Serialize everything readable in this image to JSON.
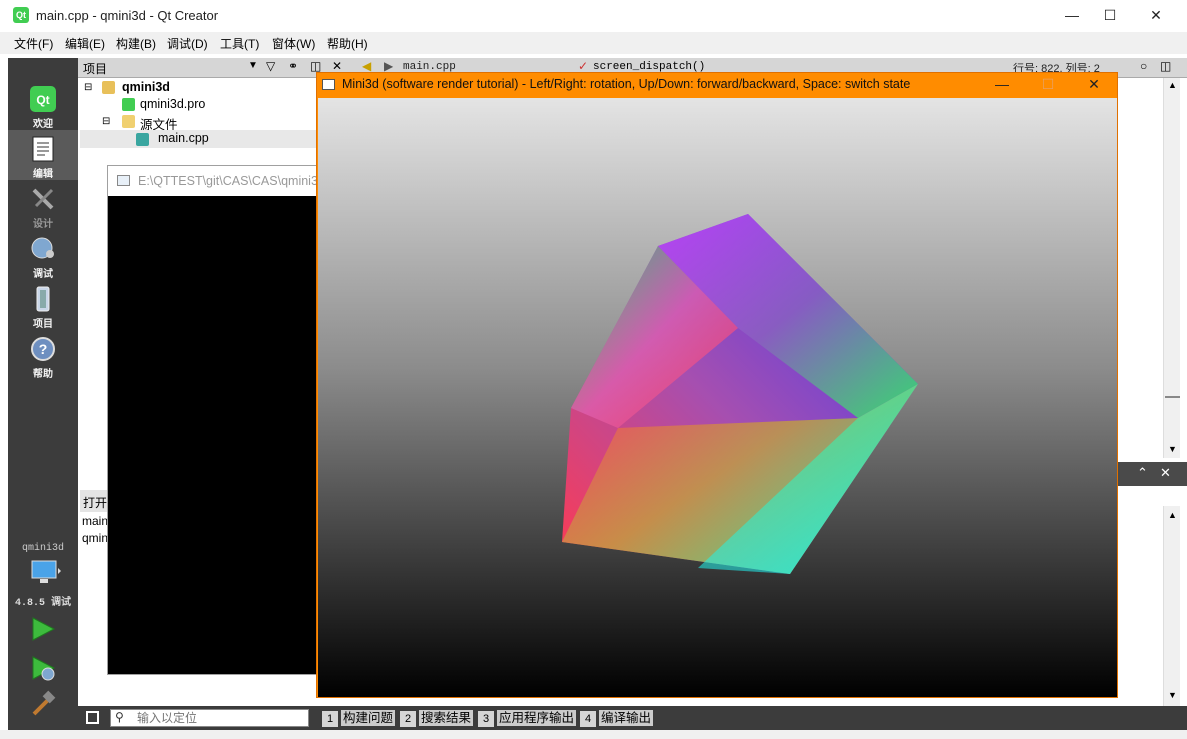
{
  "qt_creator": {
    "title": "main.cpp - qmini3d - Qt Creator",
    "icon": "qt-logo-icon",
    "menu": [
      "文件(F)",
      "编辑(E)",
      "构建(B)",
      "调试(D)",
      "工具(T)",
      "窗体(W)",
      "帮助(H)"
    ],
    "window_controls": [
      "minimize",
      "maximize",
      "close"
    ]
  },
  "modes": [
    {
      "label": "欢迎",
      "icon": "qt-welcome-icon",
      "color": "#41cd52"
    },
    {
      "label": "编辑",
      "icon": "edit-document-icon",
      "active": true
    },
    {
      "label": "设计",
      "icon": "design-tools-icon"
    },
    {
      "label": "调试",
      "icon": "debug-bug-icon"
    },
    {
      "label": "项目",
      "icon": "project-wrench-icon"
    },
    {
      "label": "帮助",
      "icon": "help-question-icon"
    }
  ],
  "project_pane": {
    "title": "项目",
    "tree": [
      {
        "label": "qmini3d",
        "level": 0,
        "bold": true,
        "icon": "qt-project-icon"
      },
      {
        "label": "qmini3d.pro",
        "level": 1,
        "icon": "pro-file-icon"
      },
      {
        "label": "源文件",
        "level": 1,
        "icon": "source-folder-icon"
      },
      {
        "label": "main.cpp",
        "level": 2,
        "icon": "cpp-file-icon",
        "selected": true
      }
    ]
  },
  "editor": {
    "file": "main.cpp",
    "function": "screen_dispatch()",
    "position": "行号: 822, 列号: 2"
  },
  "open_documents": {
    "title": "打开",
    "items": [
      "main",
      "qmin"
    ]
  },
  "console": {
    "title": "E:\\QTTEST\\git\\CAS\\CAS\\qmini3"
  },
  "kit": {
    "project": "qmini3d",
    "version": "4.8.5 调试",
    "actions": [
      "run-icon",
      "debug-run-icon",
      "build-hammer-icon"
    ]
  },
  "statusbar": {
    "locator_placeholder": "输入以定位",
    "output_tabs": [
      {
        "num": "1",
        "label": "构建问题"
      },
      {
        "num": "2",
        "label": "搜索结果"
      },
      {
        "num": "3",
        "label": "应用程序输出"
      },
      {
        "num": "4",
        "label": "编译输出"
      }
    ]
  },
  "mini3d": {
    "title": "Mini3d (software render tutorial) - Left/Right: rotation, Up/Down: forward/backward, Space: switch state",
    "title_bar_color": "#ff8c00"
  }
}
